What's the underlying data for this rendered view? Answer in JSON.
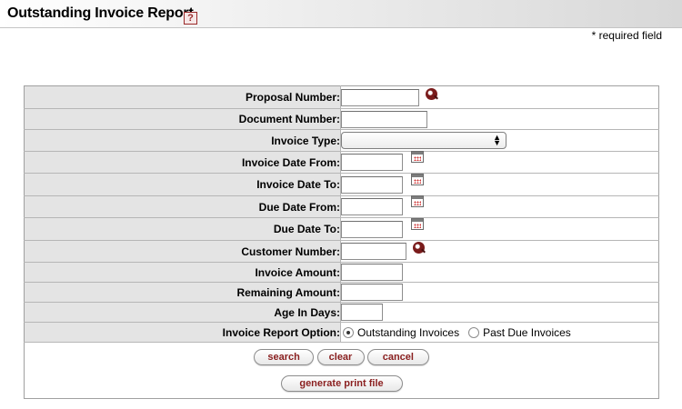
{
  "header": {
    "title": "Outstanding Invoice Report",
    "help_glyph": "?"
  },
  "required_note": "* required field",
  "form": {
    "fields": [
      {
        "label": "Proposal Number:",
        "value": "",
        "control": "text-lookup"
      },
      {
        "label": "Document Number:",
        "value": "",
        "control": "text"
      },
      {
        "label": "Invoice Type:",
        "value": "",
        "control": "select"
      },
      {
        "label": "Invoice Date From:",
        "value": "",
        "control": "date"
      },
      {
        "label": "Invoice Date To:",
        "value": "",
        "control": "date"
      },
      {
        "label": "Due Date From:",
        "value": "",
        "control": "date"
      },
      {
        "label": "Due Date To:",
        "value": "",
        "control": "date"
      },
      {
        "label": "Customer Number:",
        "value": "",
        "control": "text-lookup"
      },
      {
        "label": "Invoice Amount:",
        "value": "",
        "control": "text"
      },
      {
        "label": "Remaining Amount:",
        "value": "",
        "control": "text"
      },
      {
        "label": "Age In Days:",
        "value": "",
        "control": "text"
      },
      {
        "label": "Invoice Report Option:",
        "control": "radio"
      }
    ],
    "report_options": {
      "selected": "Outstanding Invoices",
      "options": [
        "Outstanding Invoices",
        "Past Due Invoices"
      ]
    }
  },
  "buttons": {
    "search": "search",
    "clear": "clear",
    "cancel": "cancel",
    "generate_print_file": "generate print file"
  },
  "icons": {
    "help": "help-icon",
    "lookup": "lookup-icon",
    "calendar": "calendar-icon",
    "select_arrow": "select-arrow-icon"
  },
  "colors": {
    "accent": "#8a1f1f",
    "label_background": "#e4e4e4"
  }
}
